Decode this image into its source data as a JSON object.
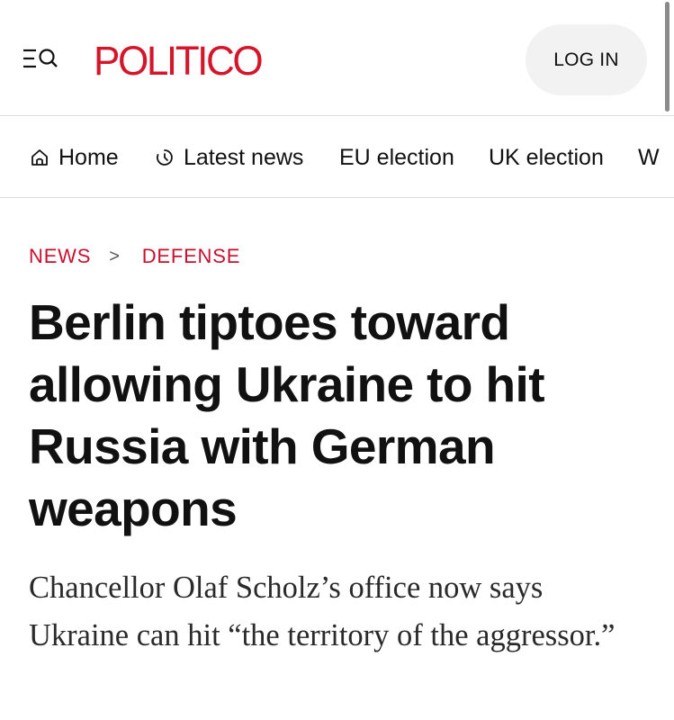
{
  "header": {
    "brand": "POLITICO",
    "login_label": "LOG IN",
    "menu_icon": "menu-search-icon",
    "brand_color": "#d3162a"
  },
  "nav": {
    "items": [
      {
        "label": "Home",
        "icon": "home-icon"
      },
      {
        "label": "Latest news",
        "icon": "clock-icon"
      },
      {
        "label": "EU election"
      },
      {
        "label": "UK election"
      },
      {
        "label": "W"
      }
    ]
  },
  "article": {
    "breadcrumb": {
      "section": "NEWS",
      "separator": ">",
      "subsection": "DEFENSE"
    },
    "headline": "Berlin tiptoes toward allowing Ukraine to hit Russia with German weapons",
    "dek": "Chancellor Olaf Scholz’s office now says Ukraine can hit “the territory of the aggressor.”"
  },
  "colors": {
    "accent_red": "#c8102e",
    "text": "#111111",
    "divider": "#dcdcdc",
    "button_bg": "#f2f2f2"
  }
}
